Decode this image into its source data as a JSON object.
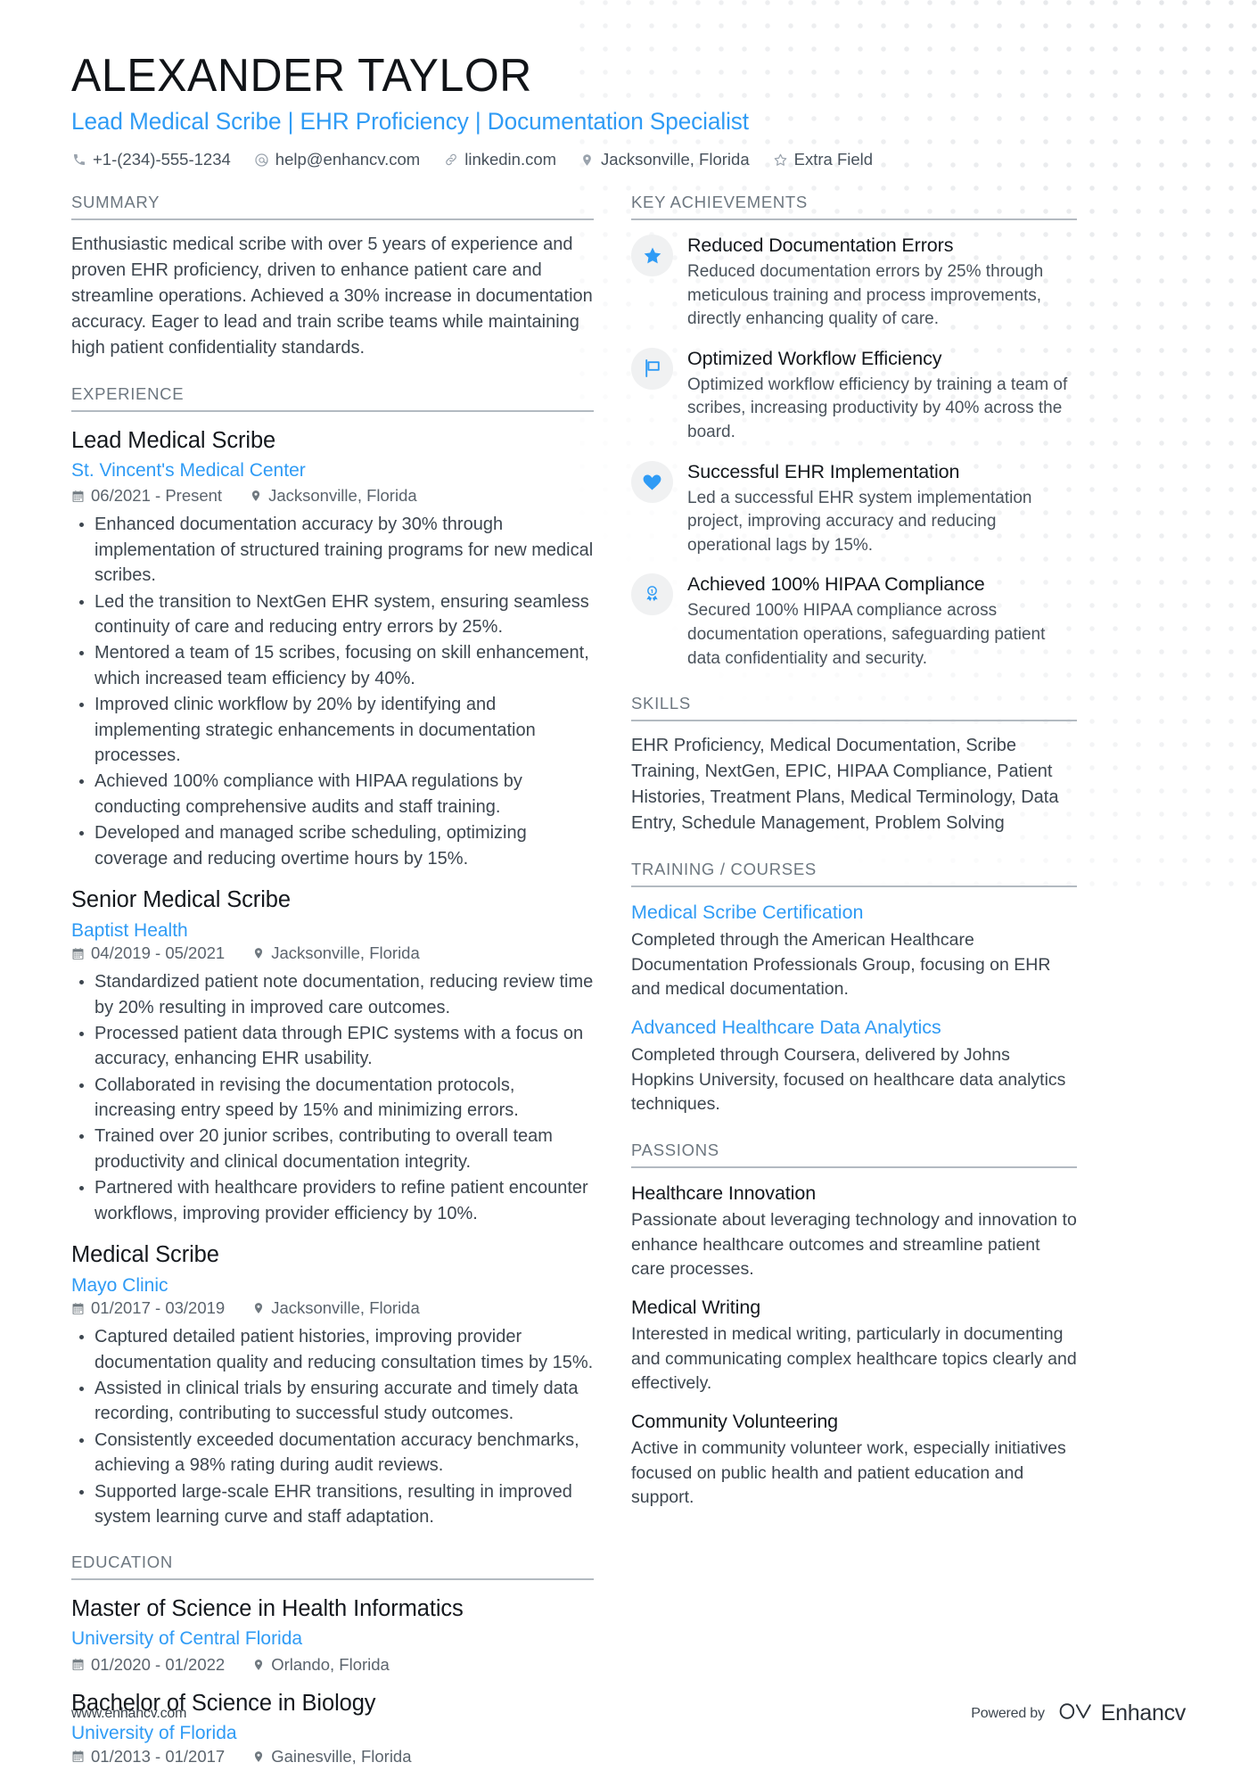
{
  "header": {
    "name": "ALEXANDER TAYLOR",
    "headline": "Lead Medical Scribe | EHR Proficiency | Documentation Specialist",
    "contacts": [
      {
        "icon": "phone-icon",
        "text": "+1-(234)-555-1234"
      },
      {
        "icon": "email-icon",
        "text": "help@enhancv.com"
      },
      {
        "icon": "link-icon",
        "text": "linkedin.com"
      },
      {
        "icon": "location-icon",
        "text": "Jacksonville, Florida"
      },
      {
        "icon": "star-icon",
        "text": "Extra Field"
      }
    ]
  },
  "sections": {
    "summary_title": "SUMMARY",
    "experience_title": "EXPERIENCE",
    "education_title": "EDUCATION",
    "key_achievements_title": "KEY ACHIEVEMENTS",
    "skills_title": "SKILLS",
    "training_title": "TRAINING / COURSES",
    "passions_title": "PASSIONS"
  },
  "summary": {
    "text": "Enthusiastic medical scribe with over 5 years of experience and proven EHR proficiency, driven to enhance patient care and streamline operations. Achieved a 30% increase in documentation accuracy. Eager to lead and train scribe teams while maintaining high patient confidentiality standards."
  },
  "experience": [
    {
      "title": "Lead Medical Scribe",
      "organization": "St. Vincent's Medical Center",
      "dates": "06/2021 - Present",
      "location": "Jacksonville, Florida",
      "layout": "stacked",
      "bullets": [
        "Enhanced documentation accuracy by 30% through implementation of structured training programs for new medical scribes.",
        "Led the transition to NextGen EHR system, ensuring seamless continuity of care and reducing entry errors by 25%.",
        "Mentored a team of 15 scribes, focusing on skill enhancement, which increased team efficiency by 40%.",
        "Improved clinic workflow by 20% by identifying and implementing strategic enhancements in documentation processes.",
        "Achieved 100% compliance with HIPAA regulations by conducting comprehensive audits and staff training.",
        "Developed and managed scribe scheduling, optimizing coverage and reducing overtime hours by 15%."
      ]
    },
    {
      "title": "Senior Medical Scribe",
      "organization": "Baptist Health",
      "dates": "04/2019 - 05/2021",
      "location": "Jacksonville, Florida",
      "layout": "inline",
      "bullets": [
        "Standardized patient note documentation, reducing review time by 20% resulting in improved care outcomes.",
        "Processed patient data through EPIC systems with a focus on accuracy, enhancing EHR usability.",
        "Collaborated in revising the documentation protocols, increasing entry speed by 15% and minimizing errors.",
        "Trained over 20 junior scribes, contributing to overall team productivity and clinical documentation integrity.",
        "Partnered with healthcare providers to refine patient encounter workflows, improving provider efficiency by 10%."
      ]
    },
    {
      "title": "Medical Scribe",
      "organization": "Mayo Clinic",
      "dates": "01/2017 - 03/2019",
      "location": "Jacksonville, Florida",
      "layout": "inline",
      "bullets": [
        "Captured detailed patient histories, improving provider documentation quality and reducing consultation times by 15%.",
        "Assisted in clinical trials by ensuring accurate and timely data recording, contributing to successful study outcomes.",
        "Consistently exceeded documentation accuracy benchmarks, achieving a 98% rating during audit reviews.",
        "Supported large-scale EHR transitions, resulting in improved system learning curve and staff adaptation."
      ]
    }
  ],
  "education": [
    {
      "title": "Master of Science in Health Informatics",
      "organization": "University of Central Florida",
      "dates": "01/2020 - 01/2022",
      "location": "Orlando, Florida",
      "layout": "stacked"
    },
    {
      "title": "Bachelor of Science in Biology",
      "organization": "University of Florida",
      "dates": "01/2013 - 01/2017",
      "location": "Gainesville, Florida",
      "layout": "inline"
    }
  ],
  "key_achievements": [
    {
      "icon": "star-icon",
      "title": "Reduced Documentation Errors",
      "description": "Reduced documentation errors by 25% through meticulous training and process improvements, directly enhancing quality of care."
    },
    {
      "icon": "flag-icon",
      "title": "Optimized Workflow Efficiency",
      "description": "Optimized workflow efficiency by training a team of scribes, increasing productivity by 40% across the board."
    },
    {
      "icon": "heart-icon",
      "title": "Successful EHR Implementation",
      "description": "Led a successful EHR system implementation project, improving accuracy and reducing operational lags by 15%."
    },
    {
      "icon": "award-icon",
      "title": "Achieved 100% HIPAA Compliance",
      "description": "Secured 100% HIPAA compliance across documentation operations, safeguarding patient data confidentiality and security."
    }
  ],
  "skills": {
    "text": "EHR Proficiency, Medical Documentation, Scribe Training, NextGen, EPIC, HIPAA Compliance, Patient Histories, Treatment Plans, Medical Terminology, Data Entry, Schedule Management, Problem Solving"
  },
  "training": [
    {
      "title": "Medical Scribe Certification",
      "description": "Completed through the American Healthcare Documentation Professionals Group, focusing on EHR and medical documentation."
    },
    {
      "title": "Advanced Healthcare Data Analytics",
      "description": "Completed through Coursera, delivered by Johns Hopkins University, focused on healthcare data analytics techniques."
    }
  ],
  "passions": [
    {
      "title": "Healthcare Innovation",
      "description": "Passionate about leveraging technology and innovation to enhance healthcare outcomes and streamline patient care processes."
    },
    {
      "title": "Medical Writing",
      "description": "Interested in medical writing, particularly in documenting and communicating complex healthcare topics clearly and effectively."
    },
    {
      "title": "Community Volunteering",
      "description": "Active in community volunteer work, especially initiatives focused on public health and patient education and support."
    }
  ],
  "footer": {
    "url": "www.enhancv.com",
    "powered_by": "Powered by",
    "brand": "Enhancv"
  },
  "colors": {
    "accent": "#2f9bf5",
    "heading": "#14181d",
    "body": "#3d464f",
    "muted": "#6d7780",
    "badge_bg": "#f0f1f2",
    "rule": "#b3bac1"
  }
}
